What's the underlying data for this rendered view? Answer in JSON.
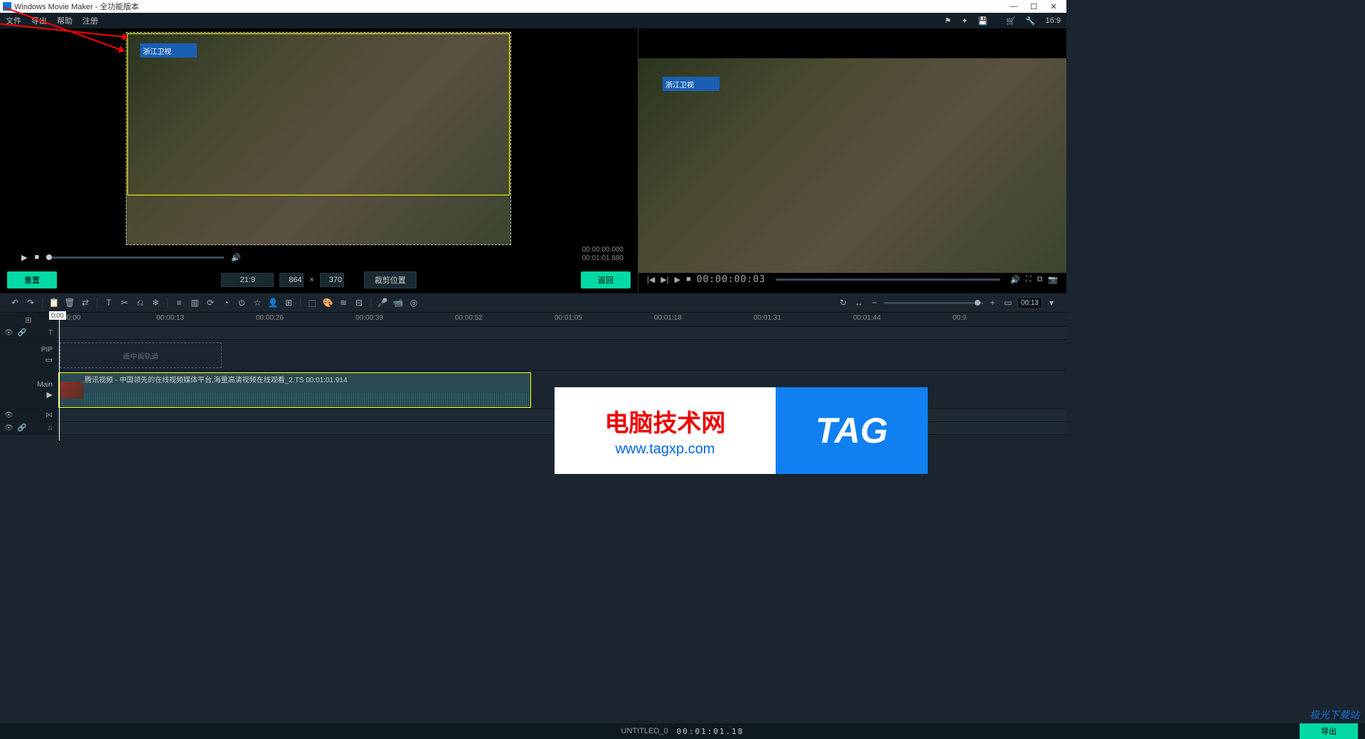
{
  "titlebar": {
    "app_name": "Windows Movie Maker",
    "suffix": " - 全功能版本"
  },
  "menu": {
    "file": "文件",
    "export": "导出",
    "help": "帮助",
    "register": "注册",
    "aspect": "16:9"
  },
  "crop": {
    "reset": "重置",
    "ratio": "21:9",
    "width": "864",
    "times": "×",
    "height": "370",
    "crop_pos": "裁剪位置",
    "back": "返回",
    "time_current": "00:00:00.000",
    "time_total": "00:01:01.880"
  },
  "channel_logo": "浙江卫视",
  "preview": {
    "timecode": "00:00:00:03"
  },
  "toolbar": {
    "zoom_label": "00:13"
  },
  "ruler": {
    "ticks": [
      "0:00:00",
      "00:00:13",
      "00:00:26",
      "00:00:39",
      "00:00:52",
      "00:01:05",
      "00:01:18",
      "00:01:31",
      "00:01:44",
      "00:0"
    ],
    "playhead_label": "0:00",
    "pip_label": "PIP",
    "pip_placeholder": "画中画轨道",
    "main_label": "Main",
    "clip_title": "腾讯视频 - 中国领先的在线视频媒体平台,海量高清视频在线观看_2.TS  00:01:01.914"
  },
  "watermark": {
    "line1": "电脑技术网",
    "line2": "www.tagxp.com",
    "tag": "TAG",
    "corner": "极光下载站"
  },
  "status": {
    "project": "UNTITLED_0",
    "timecode": "00:01:01.18",
    "export": "导出"
  }
}
